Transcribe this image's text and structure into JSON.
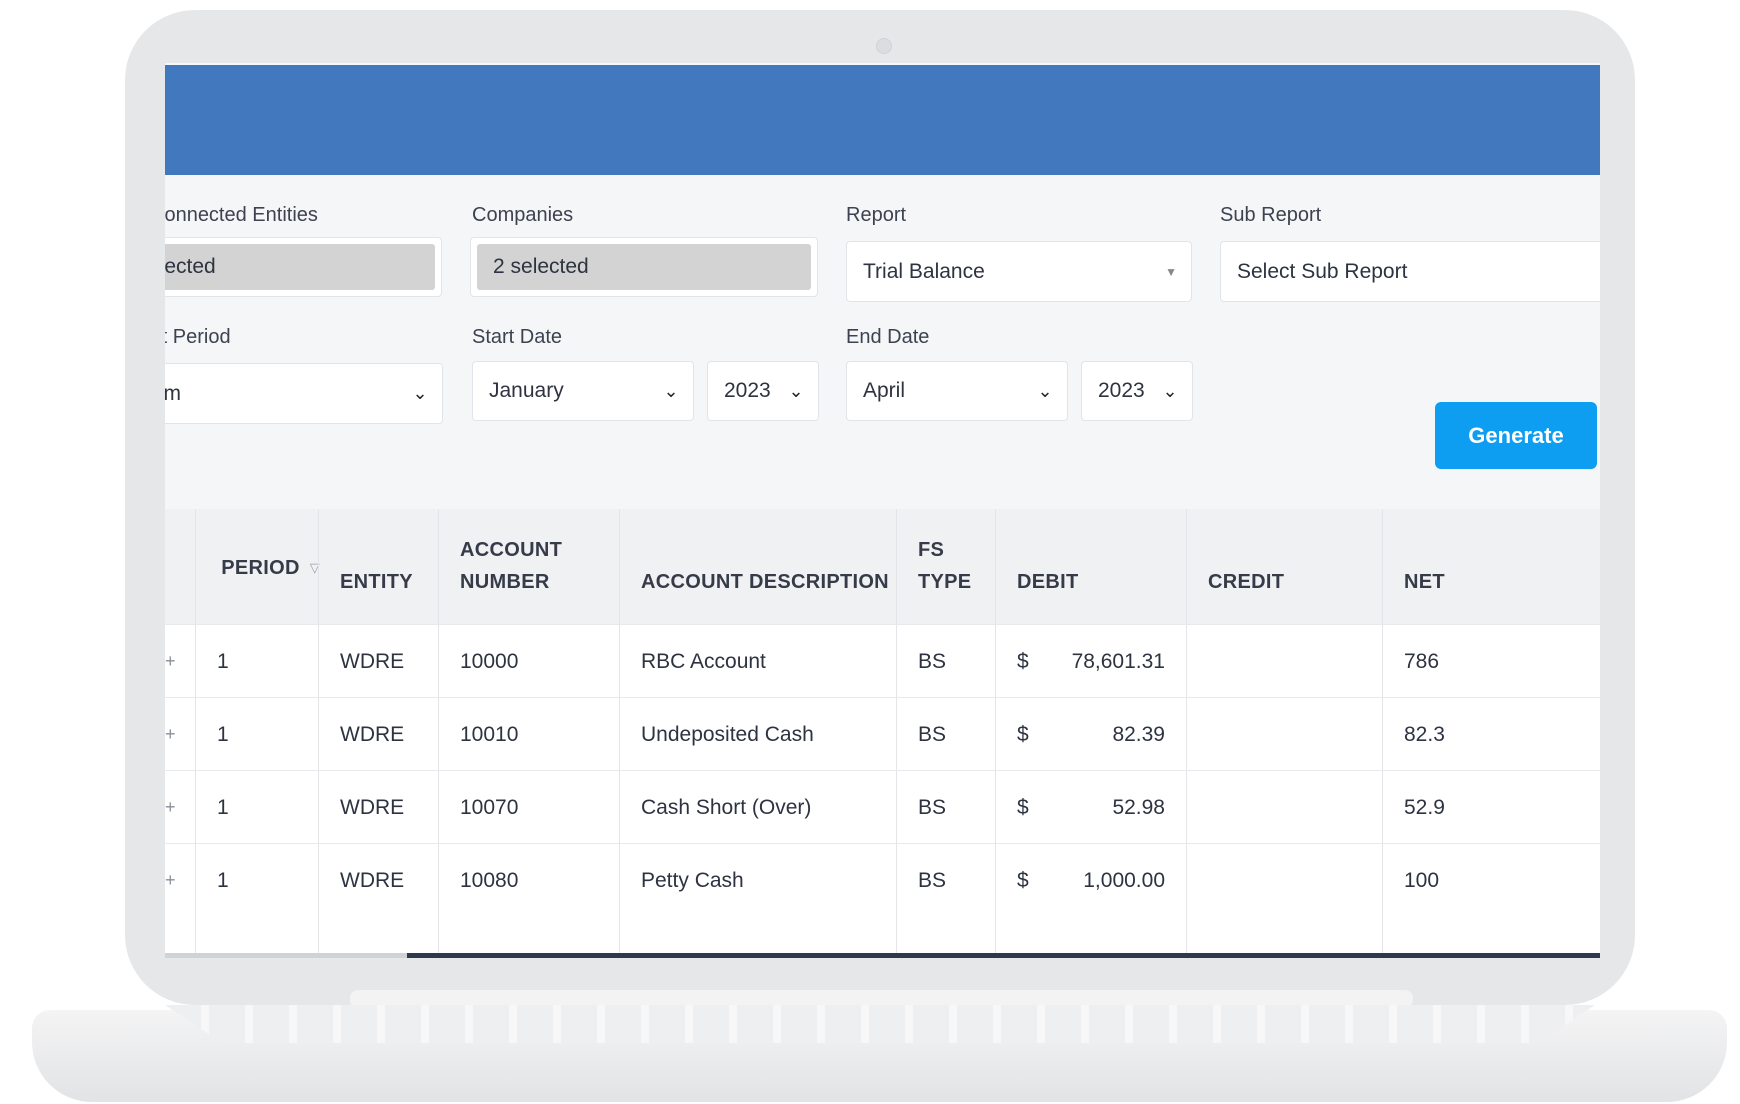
{
  "filters": {
    "connected_entities": {
      "label": "Connected Entities",
      "value": "elected"
    },
    "companies": {
      "label": "Companies",
      "value": "2 selected"
    },
    "report": {
      "label": "Report",
      "value": "Trial Balance"
    },
    "sub_report": {
      "label": "Sub Report",
      "value": "Select Sub Report"
    },
    "report_period": {
      "label": "rt Period",
      "value": "tom"
    },
    "start_date": {
      "label": "Start Date",
      "month": "January",
      "year": "2023"
    },
    "end_date": {
      "label": "End Date",
      "month": "April",
      "year": "2023"
    },
    "generate_label": "Generate"
  },
  "table": {
    "headers": {
      "period": "PERIOD",
      "entity": "ENTITY",
      "account_number_1": "ACCOUNT",
      "account_number_2": "NUMBER",
      "account_description": "ACCOUNT DESCRIPTION",
      "fs_type_1": "FS",
      "fs_type_2": "TYPE",
      "debit": "DEBIT",
      "credit": "CREDIT",
      "net": "NET"
    },
    "rows": [
      {
        "period": "1",
        "entity": "WDRE",
        "account": "10000",
        "description": "RBC Account",
        "fs": "BS",
        "cur": "$",
        "debit": "78,601.31",
        "credit": "",
        "net": "786"
      },
      {
        "period": "1",
        "entity": "WDRE",
        "account": "10010",
        "description": "Undeposited Cash",
        "fs": "BS",
        "cur": "$",
        "debit": "82.39",
        "credit": "",
        "net": "82.3"
      },
      {
        "period": "1",
        "entity": "WDRE",
        "account": "10070",
        "description": "Cash Short (Over)",
        "fs": "BS",
        "cur": "$",
        "debit": "52.98",
        "credit": "",
        "net": "52.9"
      },
      {
        "period": "1",
        "entity": "WDRE",
        "account": "10080",
        "description": "Petty Cash",
        "fs": "BS",
        "cur": "$",
        "debit": "1,000.00",
        "credit": "",
        "net": "100"
      }
    ]
  },
  "colors": {
    "topbar": "#4178be",
    "primary_button": "#0d9ef2"
  },
  "icons": [
    "chevron-down-icon",
    "caret-down-icon",
    "sort-down-icon",
    "expand-plus-icon",
    "camera-icon"
  ]
}
